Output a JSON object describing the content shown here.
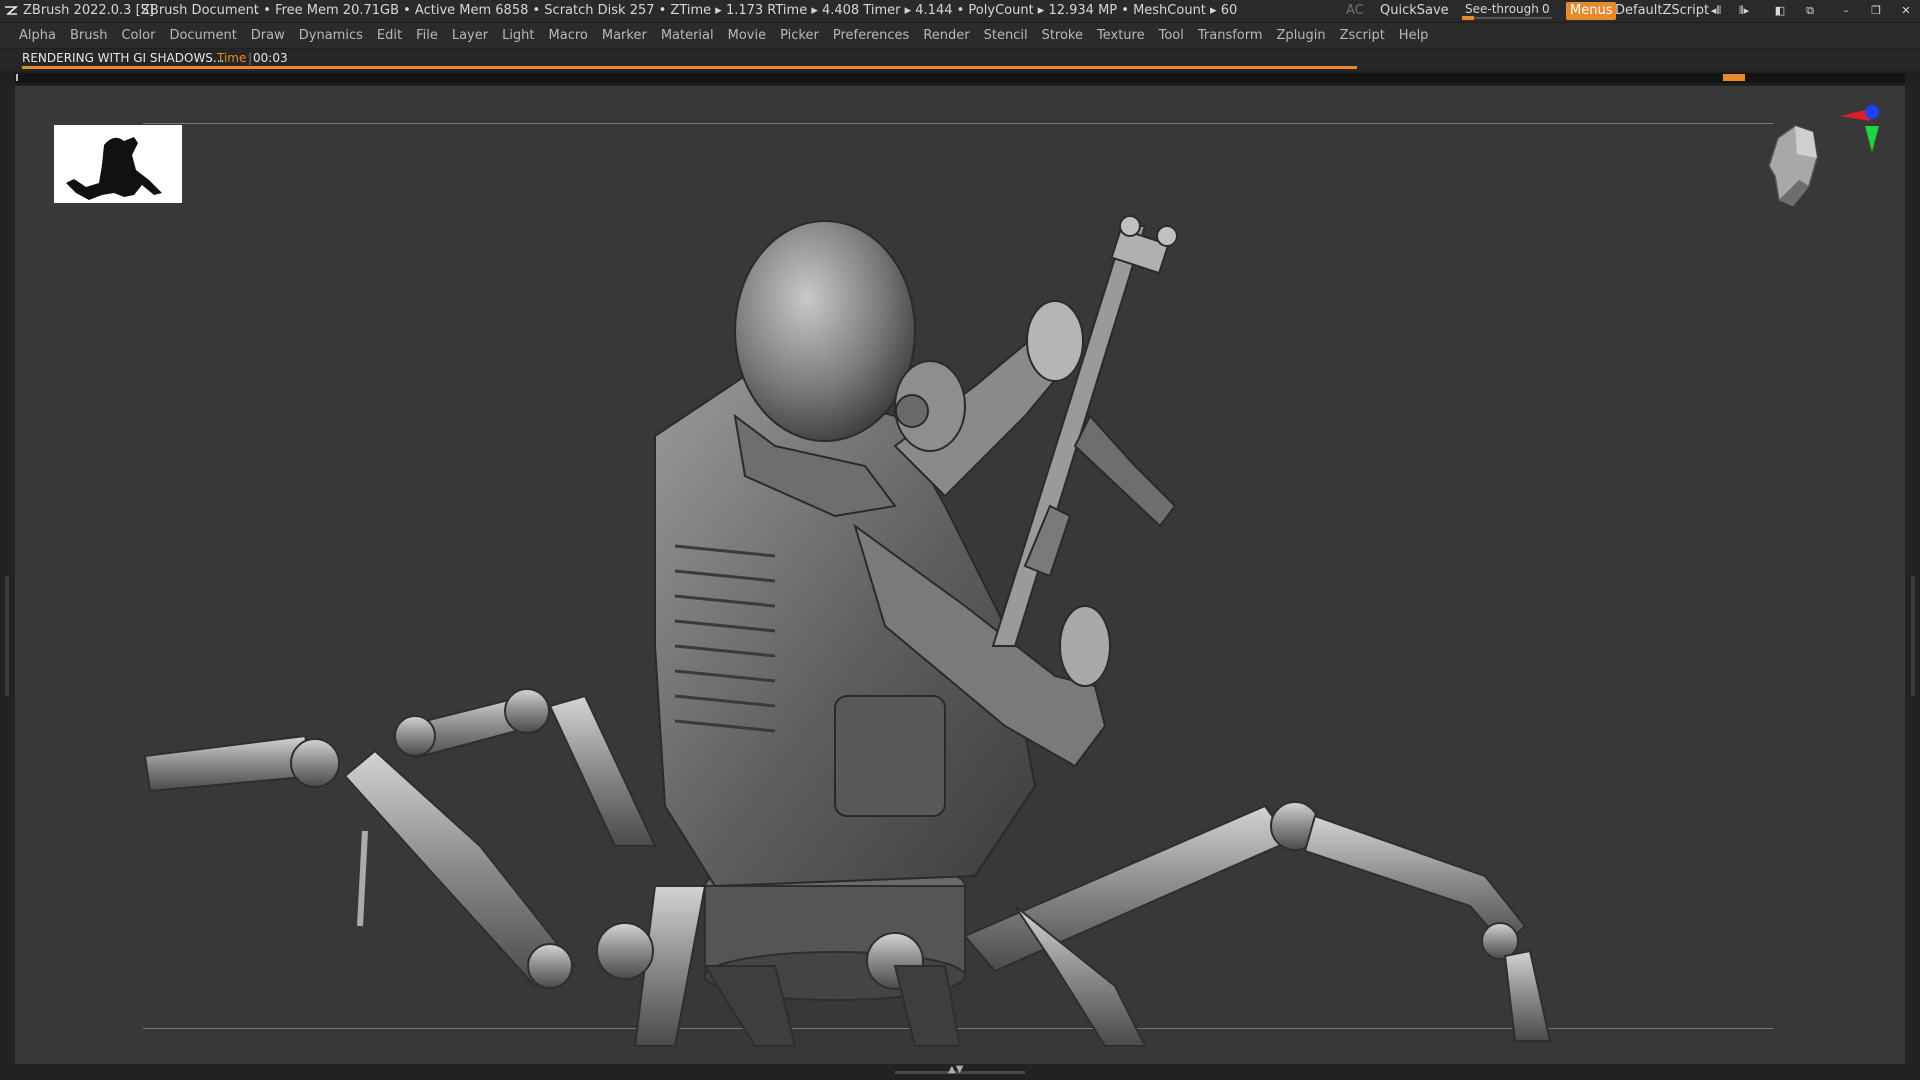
{
  "titlebar": {
    "app_title": "ZBrush 2022.0.3 [S]",
    "document_title": "ZBrush Document",
    "stats": ". • Free Mem 20.71GB • Active Mem 6858 • Scratch Disk 257 •  ZTime ▸ 1.173 RTime ▸ 4.408 Timer ▸ 4.144 • PolyCount ▸ 12.934 MP  • MeshCount ▸ 60",
    "ac_label": "AC",
    "quicksave_label": "QuickSave",
    "seethrough_label": "See-through",
    "seethrough_value": "0",
    "menus_label": "Menus",
    "script_label": "DefaultZScript"
  },
  "menubar": {
    "items": [
      "Alpha",
      "Brush",
      "Color",
      "Document",
      "Draw",
      "Dynamics",
      "Edit",
      "File",
      "Layer",
      "Light",
      "Macro",
      "Marker",
      "Material",
      "Movie",
      "Picker",
      "Preferences",
      "Render",
      "Stencil",
      "Stroke",
      "Texture",
      "Tool",
      "Transform",
      "Zplugin",
      "Zscript",
      "Help"
    ]
  },
  "status": {
    "message": "RENDERING WITH GI SHADOWS...",
    "time_label": "Time",
    "time_separator": "|",
    "time_value": "00:03"
  },
  "colors": {
    "accent": "#e58a2e",
    "canvas_bg": "#383838",
    "ui_bg": "#2b2b2b",
    "gizmo_red": "#e02020",
    "gizmo_green": "#20d040",
    "gizmo_blue": "#2040ff"
  },
  "icons": {
    "logo": "zbrush-logo-icon",
    "gizmo": "navigation-gizmo-icon",
    "orientation": "head-orientation-icon"
  }
}
